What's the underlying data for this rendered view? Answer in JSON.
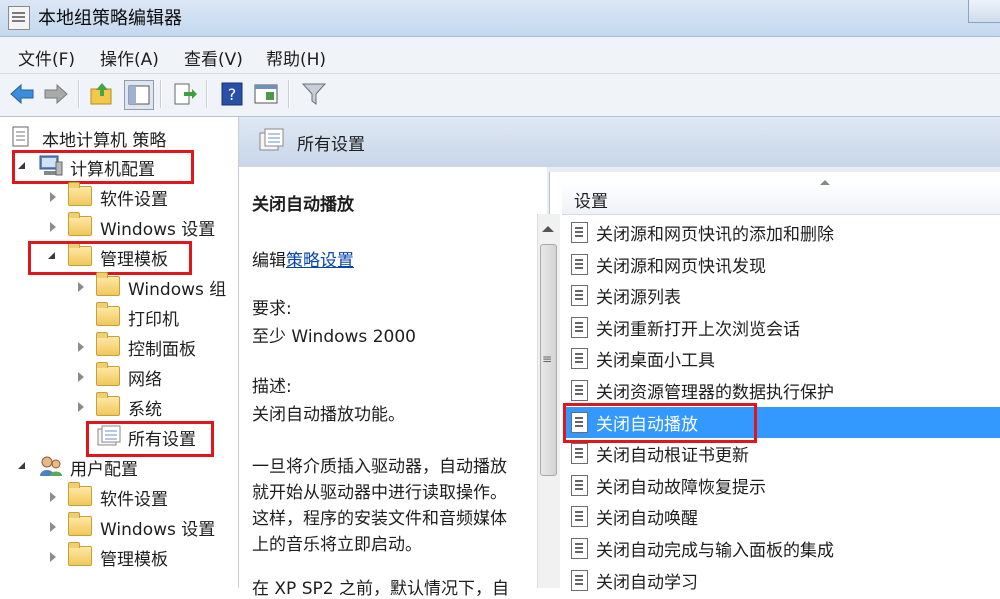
{
  "window": {
    "title": "本地组策略编辑器"
  },
  "menu": [
    "文件(F)",
    "操作(A)",
    "查看(V)",
    "帮助(H)"
  ],
  "toolbar": {
    "icons": [
      "back-arrow-icon",
      "forward-arrow-icon",
      "up-folder-icon",
      "show-hide-tree-icon",
      "export-list-icon",
      "help-icon",
      "properties-icon",
      "filter-icon"
    ]
  },
  "tree": {
    "root": "本地计算机 策略",
    "computer_config": "计算机配置",
    "software_settings": "软件设置",
    "windows_settings": "Windows 设置",
    "admin_templates": "管理模板",
    "windows_components": "Windows 组",
    "printers": "打印机",
    "control_panel": "控制面板",
    "network": "网络",
    "system": "系统",
    "all_settings": "所有设置",
    "user_config": "用户配置",
    "user_software_settings": "软件设置",
    "user_windows_settings": "Windows 设置",
    "user_admin_templates": "管理模板"
  },
  "header": {
    "title": "所有设置"
  },
  "description": {
    "title": "关闭自动播放",
    "edit_prefix": "编辑",
    "edit_link": "策略设置",
    "requirements_label": "要求:",
    "requirements_value": "至少 Windows 2000",
    "desc_label": "描述:",
    "desc_line1": "关闭自动播放功能。",
    "para_line1": "一旦将介质插入驱动器，自动播放",
    "para_line2": "就开始从驱动器中进行读取操作。",
    "para_line3": "这样，程序的安装文件和音频媒体",
    "para_line4": "上的音乐将立即启动。",
    "para_line5": "在 XP SP2 之前，默认情况下，自"
  },
  "list": {
    "column": "设置",
    "items": [
      "关闭源和网页快讯的添加和删除",
      "关闭源和网页快讯发现",
      "关闭源列表",
      "关闭重新打开上次浏览会话",
      "关闭桌面小工具",
      "关闭资源管理器的数据执行保护",
      "关闭自动播放",
      "关闭自动根证书更新",
      "关闭自动故障恢复提示",
      "关闭自动唤醒",
      "关闭自动完成与输入面板的集成",
      "关闭自动学习"
    ],
    "selected_index": 6
  },
  "colors": {
    "selection": "#3399ff",
    "highlight_box": "#e0161b"
  }
}
